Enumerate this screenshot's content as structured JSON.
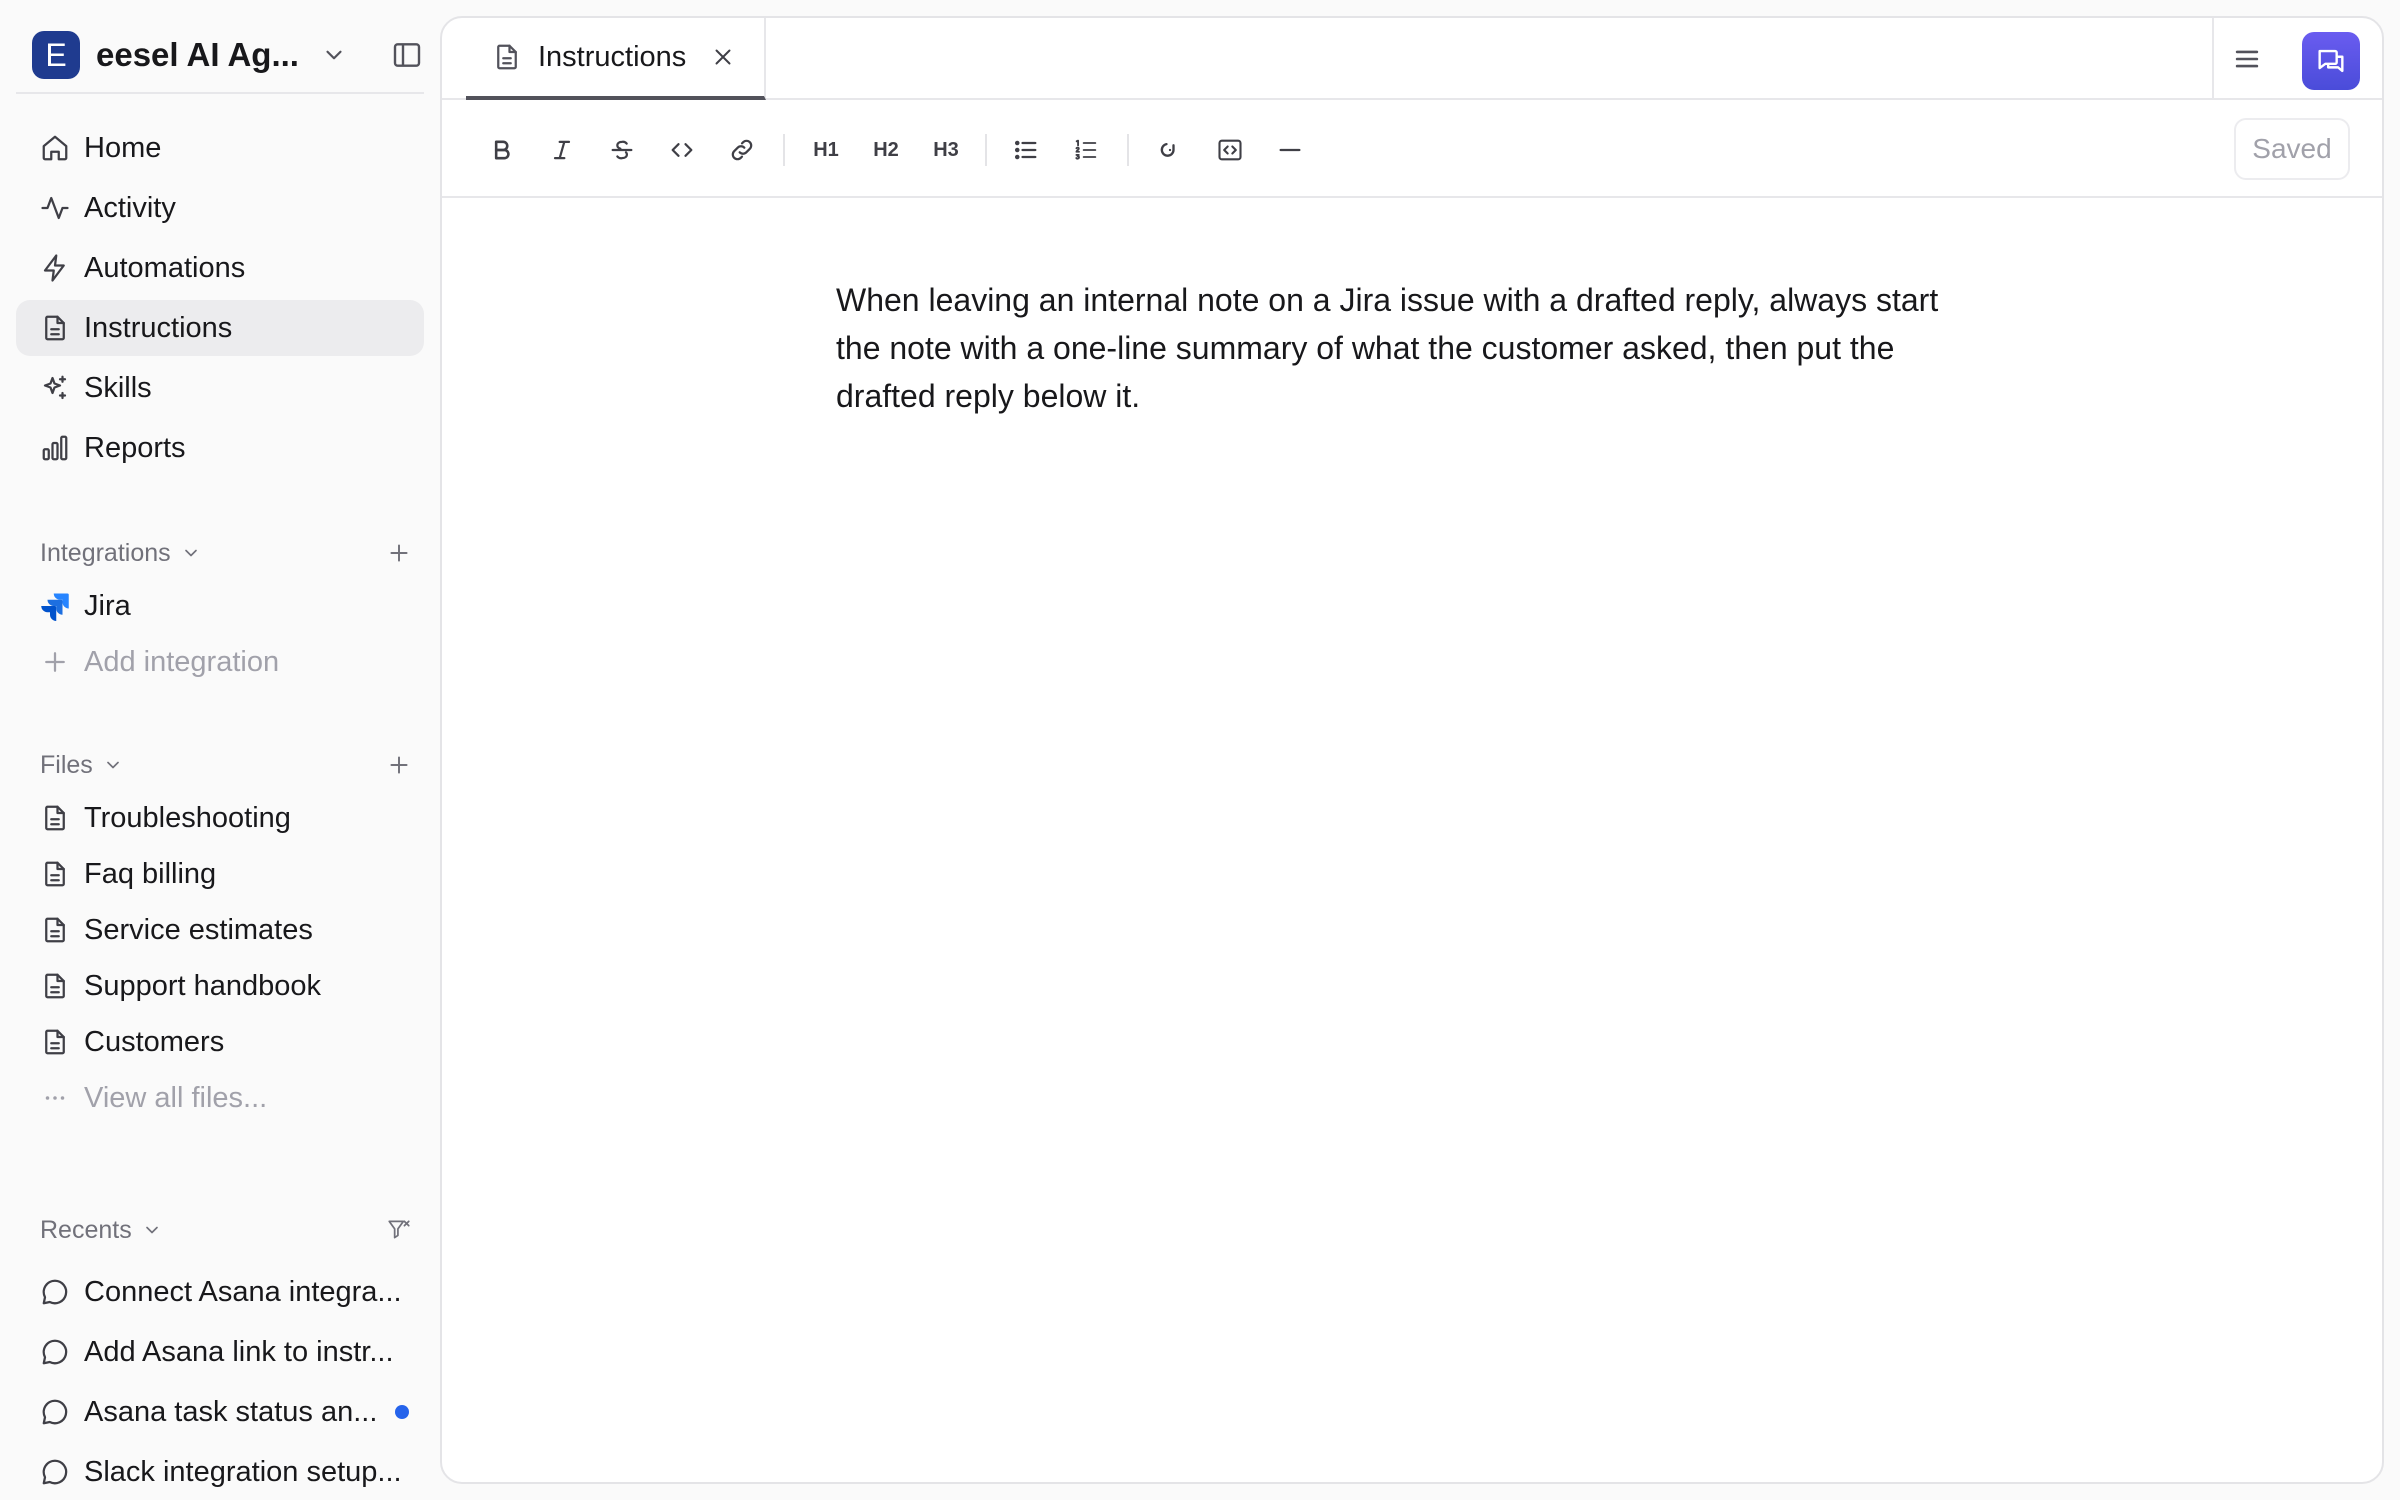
{
  "workspace": {
    "initial": "E",
    "name": "eesel AI Ag..."
  },
  "nav": [
    {
      "label": "Home",
      "icon": "home-icon"
    },
    {
      "label": "Activity",
      "icon": "activity-icon"
    },
    {
      "label": "Automations",
      "icon": "bolt-icon"
    },
    {
      "label": "Instructions",
      "icon": "document-icon",
      "active": true
    },
    {
      "label": "Skills",
      "icon": "sparkles-icon"
    },
    {
      "label": "Reports",
      "icon": "bar-chart-icon"
    }
  ],
  "integrations": {
    "heading": "Integrations",
    "items": [
      {
        "label": "Jira",
        "icon": "jira-logo-icon"
      }
    ],
    "add_label": "Add integration"
  },
  "files": {
    "heading": "Files",
    "items": [
      {
        "label": "Troubleshooting"
      },
      {
        "label": "Faq billing"
      },
      {
        "label": "Service estimates"
      },
      {
        "label": "Support handbook"
      },
      {
        "label": "Customers"
      }
    ],
    "view_all_label": "View all files..."
  },
  "recents": {
    "heading": "Recents",
    "items": [
      {
        "label": "Connect Asana integra...",
        "unread": false
      },
      {
        "label": "Add Asana link to instr...",
        "unread": false
      },
      {
        "label": "Asana task status an...",
        "unread": true
      },
      {
        "label": "Slack integration setup...",
        "unread": false
      }
    ]
  },
  "tab": {
    "label": "Instructions"
  },
  "toolbar": {
    "h1": "H1",
    "h2": "H2",
    "h3": "H3",
    "saved_label": "Saved"
  },
  "editor": {
    "content": "When leaving an internal note on a Jira issue with a drafted reply, always start the note with a one-line summary of what the customer asked, then put the drafted reply below it."
  },
  "colors": {
    "accent": "#4f46e5",
    "workspace_avatar": "#1f3b8f",
    "unread_dot": "#2563eb",
    "active_nav_bg": "#ececee"
  }
}
